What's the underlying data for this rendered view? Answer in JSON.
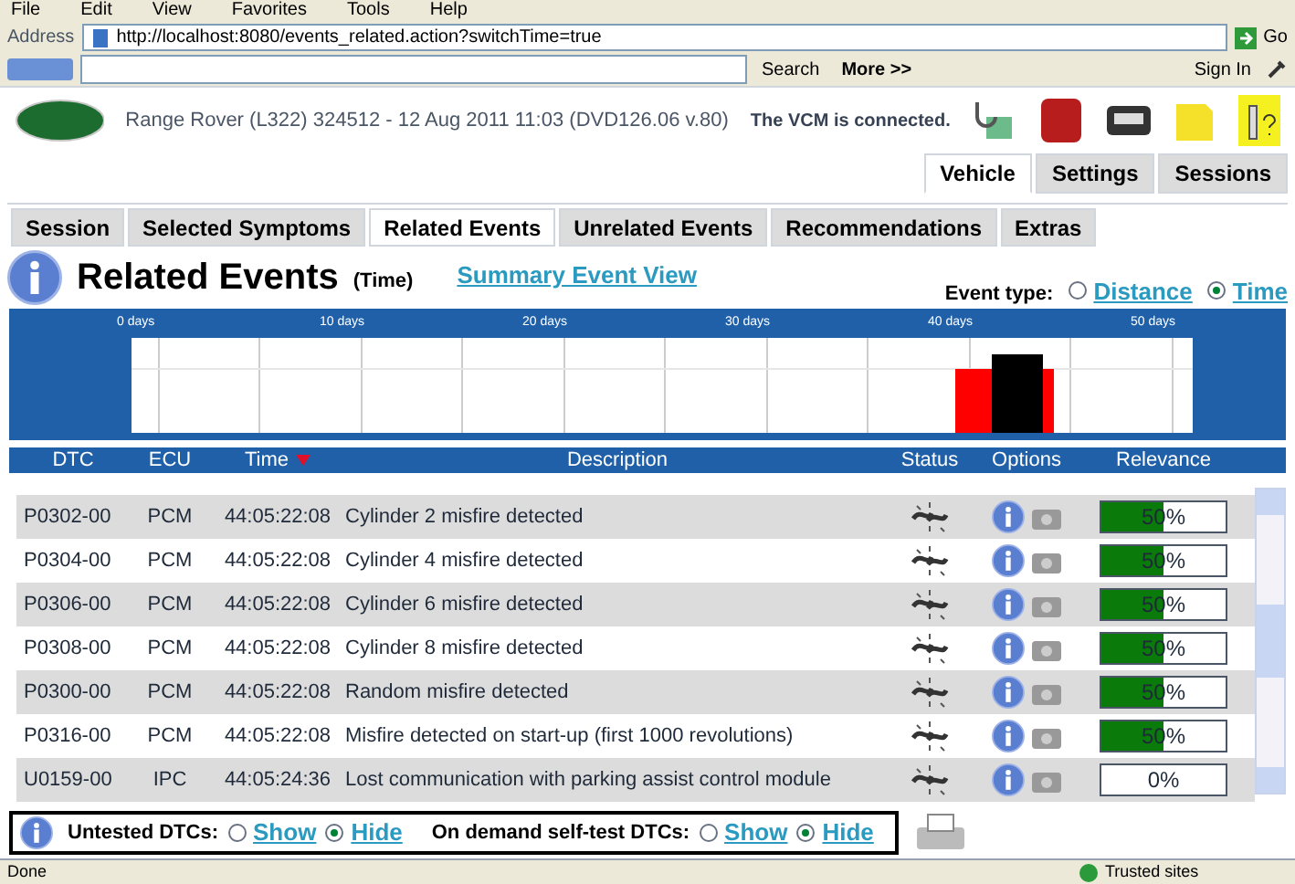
{
  "browser": {
    "menu": [
      "File",
      "Edit",
      "View",
      "Favorites",
      "Tools",
      "Help"
    ],
    "address_label": "Address",
    "url": "http://localhost:8080/events_related.action?switchTime=true",
    "go": "Go",
    "search_button": "Search",
    "more": "More >>",
    "sign_in": "Sign In"
  },
  "header": {
    "vehicle_info": "Range Rover (L322) 324512 - 12 Aug 2011 11:03 (DVD126.06 v.80)",
    "vcm_status": "The VCM is connected."
  },
  "top_tabs": [
    {
      "label": "Vehicle",
      "selected": true
    },
    {
      "label": "Settings",
      "selected": false
    },
    {
      "label": "Sessions",
      "selected": false
    }
  ],
  "tabs": [
    {
      "label": "Session",
      "selected": false
    },
    {
      "label": "Selected Symptoms",
      "selected": false
    },
    {
      "label": "Related Events",
      "selected": true
    },
    {
      "label": "Unrelated Events",
      "selected": false
    },
    {
      "label": "Recommendations",
      "selected": false
    },
    {
      "label": "Extras",
      "selected": false
    }
  ],
  "page": {
    "title": "Related Events",
    "subtitle": "(Time)",
    "link": "Summary Event View",
    "event_type_label": "Event type:",
    "event_types": [
      {
        "label": "Distance",
        "selected": false
      },
      {
        "label": "Time",
        "selected": true
      }
    ]
  },
  "timeline": {
    "ticks": [
      "0 days",
      "10 days",
      "20 days",
      "30 days",
      "40 days",
      "50 days"
    ]
  },
  "table": {
    "columns": [
      {
        "label": "DTC",
        "sorted": false
      },
      {
        "label": "ECU",
        "sorted": false
      },
      {
        "label": "Time",
        "sorted": true
      },
      {
        "label": "Description",
        "sorted": false
      },
      {
        "label": "Status",
        "sorted": false
      },
      {
        "label": "Options",
        "sorted": false
      },
      {
        "label": "Relevance",
        "sorted": false
      }
    ],
    "rows": [
      {
        "dtc": "P0302-00",
        "ecu": "PCM",
        "time": "44:05:22:08",
        "description": "Cylinder 2 misfire detected",
        "level": 0.5,
        "relevance": "50%"
      },
      {
        "dtc": "P0304-00",
        "ecu": "PCM",
        "time": "44:05:22:08",
        "description": "Cylinder 4 misfire detected",
        "level": 0.5,
        "relevance": "50%"
      },
      {
        "dtc": "P0306-00",
        "ecu": "PCM",
        "time": "44:05:22:08",
        "description": "Cylinder 6 misfire detected",
        "level": 0.5,
        "relevance": "50%"
      },
      {
        "dtc": "P0308-00",
        "ecu": "PCM",
        "time": "44:05:22:08",
        "description": "Cylinder 8 misfire detected",
        "level": 0.5,
        "relevance": "50%"
      },
      {
        "dtc": "P0300-00",
        "ecu": "PCM",
        "time": "44:05:22:08",
        "description": "Random misfire detected",
        "level": 0.5,
        "relevance": "50%"
      },
      {
        "dtc": "P0316-00",
        "ecu": "PCM",
        "time": "44:05:22:08",
        "description": "Misfire detected on start-up (first 1000 revolutions)",
        "level": 0.5,
        "relevance": "50%"
      },
      {
        "dtc": "U0159-00",
        "ecu": "IPC",
        "time": "44:05:24:36",
        "description": "Lost communication with parking assist control module",
        "level": 0,
        "relevance": "0%"
      }
    ]
  },
  "footer": {
    "groups": [
      {
        "label": "Untested DTCs:",
        "options": [
          {
            "label": "Show",
            "selected": false
          },
          {
            "label": "Hide",
            "selected": true
          }
        ]
      },
      {
        "label": "On demand self-test DTCs:",
        "options": [
          {
            "label": "Show",
            "selected": false
          },
          {
            "label": "Hide",
            "selected": true
          }
        ]
      }
    ]
  },
  "status_bar": {
    "left": "Done",
    "right": "Trusted sites"
  }
}
